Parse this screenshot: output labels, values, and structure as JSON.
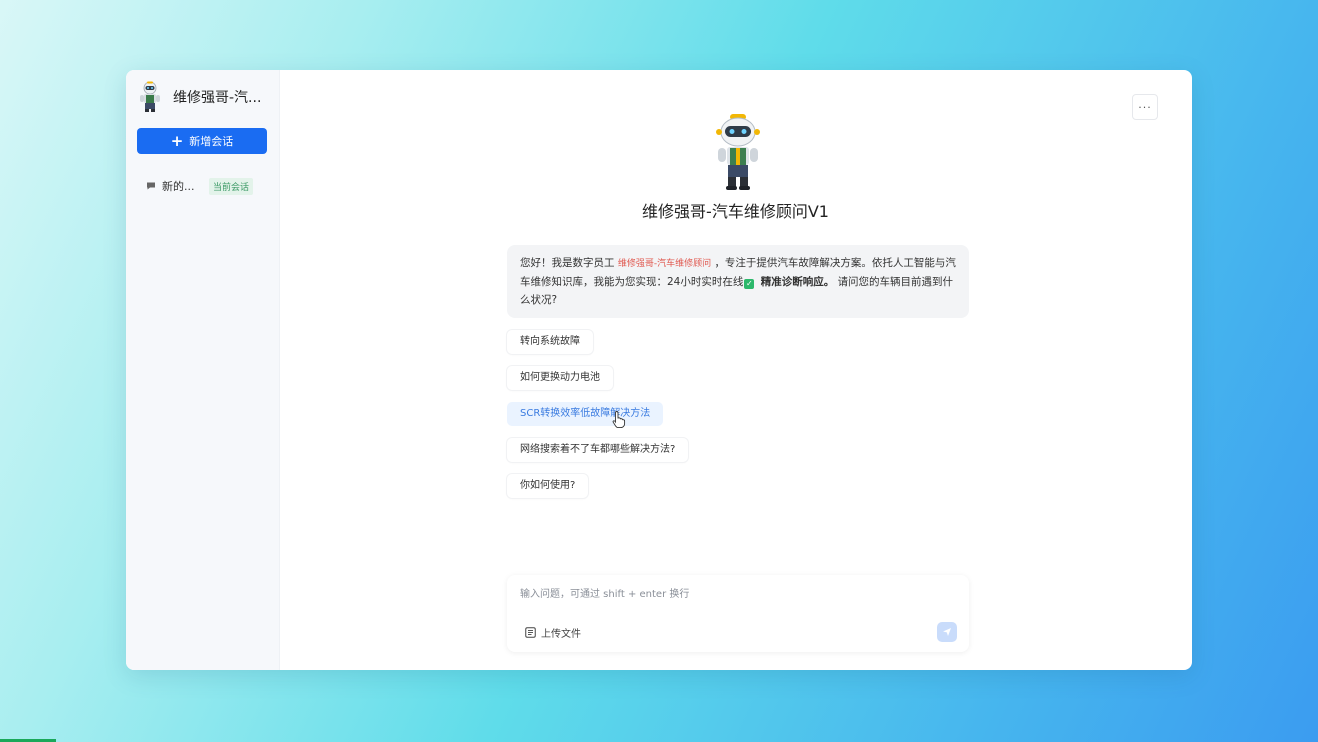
{
  "sidebar": {
    "app_name": "维修强哥-汽...",
    "new_chat_label": "新增会话",
    "sessions": [
      {
        "label": "新的...",
        "badge": "当前会话"
      }
    ]
  },
  "main": {
    "more_label": "···",
    "agent_title": "维修强哥-汽车维修顾问V1",
    "welcome": {
      "part1": "您好！我是数字员工",
      "name": "维修强哥-汽车维修顾问",
      "part2": "，专注于提供汽车故障解决方案。依托人工智能与汽车维修知识库，我能为您实现：24小时实时在线",
      "bold": "精准诊断响应。",
      "part3": "请问您的车辆目前遇到什么状况?"
    },
    "suggestions": [
      "转向系统故障",
      "如何更换动力电池",
      "SCR转换效率低故障解决方法",
      "网络搜索着不了车都哪些解决方法?",
      "你如何使用?"
    ],
    "input": {
      "value": "",
      "placeholder": "输入问题，可通过 shift + enter 换行"
    },
    "upload_label": "上传文件"
  },
  "colors": {
    "accent": "#1a6cf2",
    "badge_green": "#3c9a66",
    "highlight_red": "#e0584f"
  }
}
